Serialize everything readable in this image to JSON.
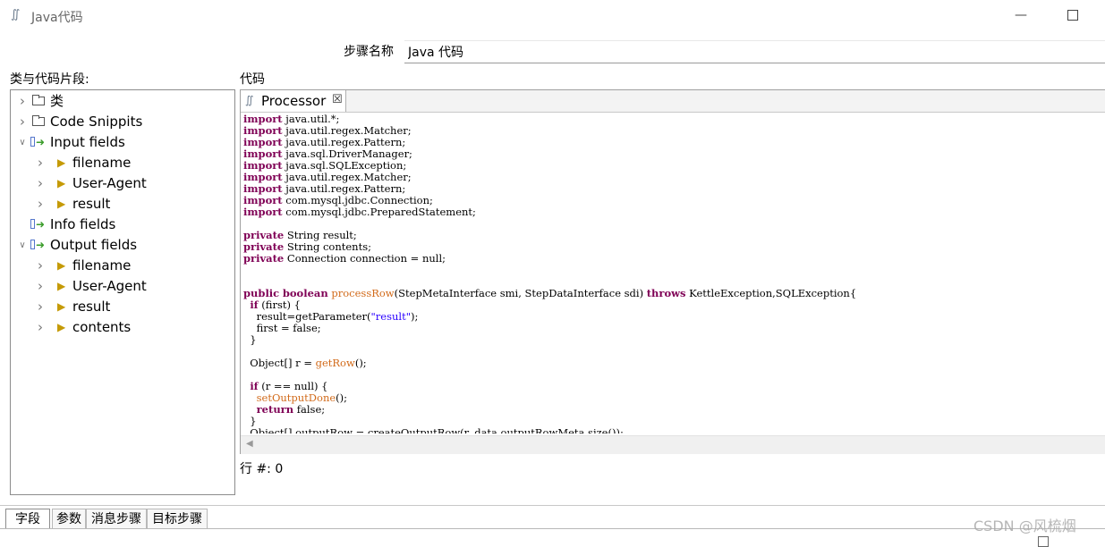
{
  "window": {
    "title": "Java代码"
  },
  "stepname": {
    "label": "步骤名称",
    "value": "Java 代码"
  },
  "left_panel": {
    "label": "类与代码片段:"
  },
  "code_panel": {
    "label": "代码"
  },
  "tree": [
    {
      "label": "类",
      "level": 0,
      "expanded": false,
      "icon": "folder-icon"
    },
    {
      "label": "Code Snippits",
      "level": 0,
      "expanded": false,
      "icon": "folder-icon"
    },
    {
      "label": "Input fields",
      "level": 0,
      "expanded": true,
      "icon": "input-fields-icon"
    },
    {
      "label": "filename",
      "level": 1,
      "expanded": false,
      "icon": "field-icon"
    },
    {
      "label": "User-Agent",
      "level": 1,
      "expanded": false,
      "icon": "field-icon"
    },
    {
      "label": "result",
      "level": 1,
      "expanded": false,
      "icon": "field-icon"
    },
    {
      "label": "Info fields",
      "level": 0,
      "expanded": null,
      "icon": "info-fields-icon"
    },
    {
      "label": "Output fields",
      "level": 0,
      "expanded": true,
      "icon": "output-fields-icon"
    },
    {
      "label": "filename",
      "level": 1,
      "expanded": false,
      "icon": "field-icon"
    },
    {
      "label": "User-Agent",
      "level": 1,
      "expanded": false,
      "icon": "field-icon"
    },
    {
      "label": "result",
      "level": 1,
      "expanded": false,
      "icon": "field-icon"
    },
    {
      "label": "contents",
      "level": 1,
      "expanded": false,
      "icon": "field-icon"
    }
  ],
  "editor": {
    "tab_label": "Processor",
    "tab_icon": "script-icon",
    "code_lines": [
      "import java.util.*;",
      "import java.util.regex.Matcher;",
      "import java.util.regex.Pattern;",
      "import java.sql.DriverManager;",
      "import java.sql.SQLException;",
      "import java.util.regex.Matcher;",
      "import java.util.regex.Pattern;",
      "import com.mysql.jdbc.Connection;",
      "import com.mysql.jdbc.PreparedStatement;",
      "",
      "private String result;",
      "private String contents;",
      "private Connection connection = null;",
      "",
      "",
      "public boolean processRow(StepMetaInterface smi, StepDataInterface sdi) throws KettleException,SQLException{",
      "  if (first) {",
      "    result=getParameter(\"result\");",
      "    first = false;",
      "  }",
      "",
      "  Object[] r = getRow();",
      "",
      "  if (r == null) {",
      "    setOutputDone();",
      "    return false;",
      "  }",
      "  Object[] outputRow = createOutputRow(r, data.outputRowMeta.size());"
    ],
    "keywords": [
      "import",
      "private",
      "public",
      "boolean",
      "throws",
      "if",
      "return"
    ],
    "methods": [
      "processRow",
      "getRow",
      "setOutputDone"
    ],
    "colors": {
      "keyword": "#7f0055",
      "method": "#d26b1b",
      "string": "#2a00ff"
    }
  },
  "status": {
    "row_label": "行 #: 0"
  },
  "bottom_tabs": [
    "字段",
    "参数",
    "消息步骤",
    "目标步骤"
  ],
  "watermark": "CSDN @风梳烟"
}
